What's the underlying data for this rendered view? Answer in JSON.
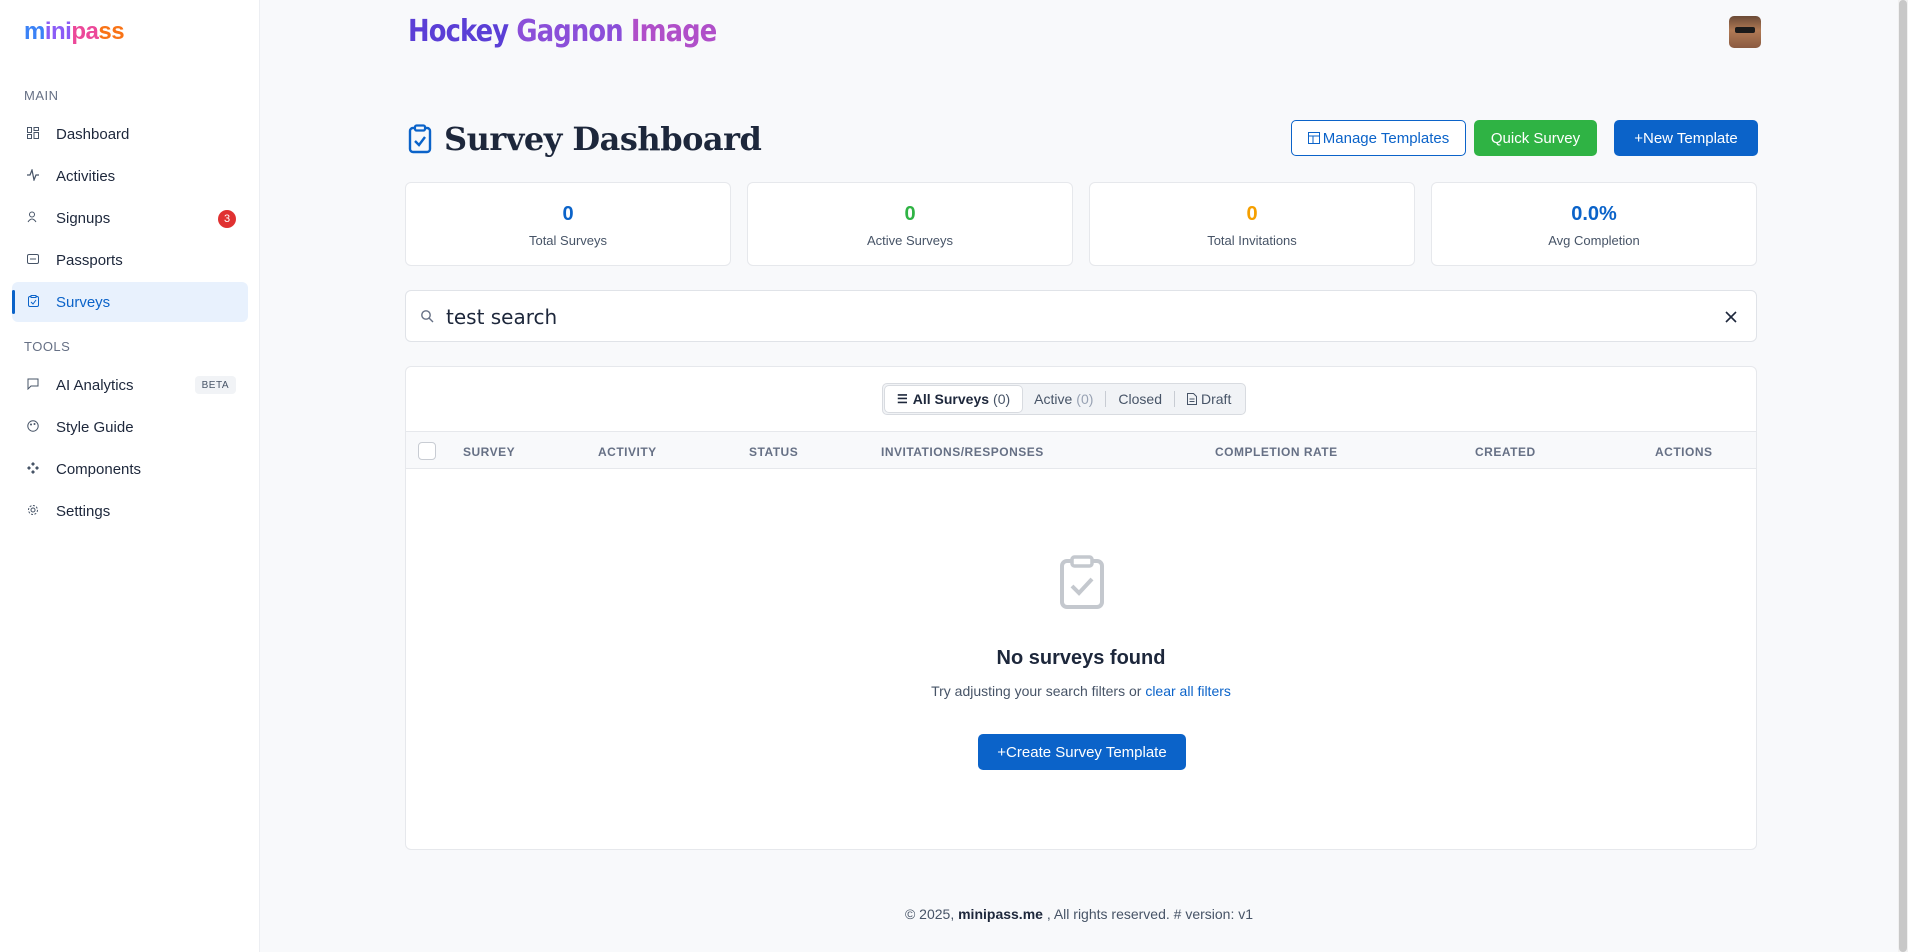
{
  "sidebar": {
    "logo": {
      "p1": "m",
      "p2": "ini",
      "p3": "pa",
      "p4": "ss"
    },
    "main_label": "MAIN",
    "tools_label": "TOOLS",
    "items": [
      {
        "label": "Dashboard",
        "icon": "dashboard-icon"
      },
      {
        "label": "Activities",
        "icon": "activity-icon"
      },
      {
        "label": "Signups",
        "icon": "user-icon",
        "badge": "3"
      },
      {
        "label": "Passports",
        "icon": "ticket-icon"
      },
      {
        "label": "Surveys",
        "icon": "clipboard-icon",
        "active": true
      },
      {
        "label": "AI Analytics",
        "icon": "message-icon",
        "badge": "BETA"
      },
      {
        "label": "Style Guide",
        "icon": "palette-icon"
      },
      {
        "label": "Components",
        "icon": "components-icon"
      },
      {
        "label": "Settings",
        "icon": "gear-icon"
      }
    ]
  },
  "header": {
    "brand_w1": "Hockey",
    "brand_w2": "Gagnon",
    "brand_w3": "Image"
  },
  "page": {
    "title": "Survey Dashboard",
    "buttons": {
      "manage": "Manage Templates",
      "quick": "Quick Survey",
      "new": "+New Template"
    }
  },
  "stats": [
    {
      "value": "0",
      "label": "Total Surveys",
      "color": "#0b63c9"
    },
    {
      "value": "0",
      "label": "Active Surveys",
      "color": "#2fb344"
    },
    {
      "value": "0",
      "label": "Total Invitations",
      "color": "#f59f00"
    },
    {
      "value": "0.0%",
      "label": "Avg Completion",
      "color": "#0b63c9"
    }
  ],
  "search": {
    "value": "test search"
  },
  "tabs": [
    {
      "label": "All Surveys",
      "count": "(0)"
    },
    {
      "label": "Active",
      "count": "(0)"
    },
    {
      "label": "Closed"
    },
    {
      "label": "Draft"
    }
  ],
  "table": {
    "columns": [
      "SURVEY",
      "ACTIVITY",
      "STATUS",
      "INVITATIONS/RESPONSES",
      "COMPLETION RATE",
      "CREATED",
      "ACTIONS"
    ]
  },
  "empty": {
    "title": "No surveys found",
    "text": "Try adjusting your search filters or",
    "link": "clear all filters",
    "button": "+Create Survey Template"
  },
  "footer": {
    "prefix": "© 2025,",
    "brand": "minipass.me",
    "suffix": ", All rights reserved. # version: v1"
  },
  "colors": {
    "accent": "#0b63c9",
    "success": "#2fb344",
    "warning": "#f59f00",
    "danger": "#e03131"
  }
}
